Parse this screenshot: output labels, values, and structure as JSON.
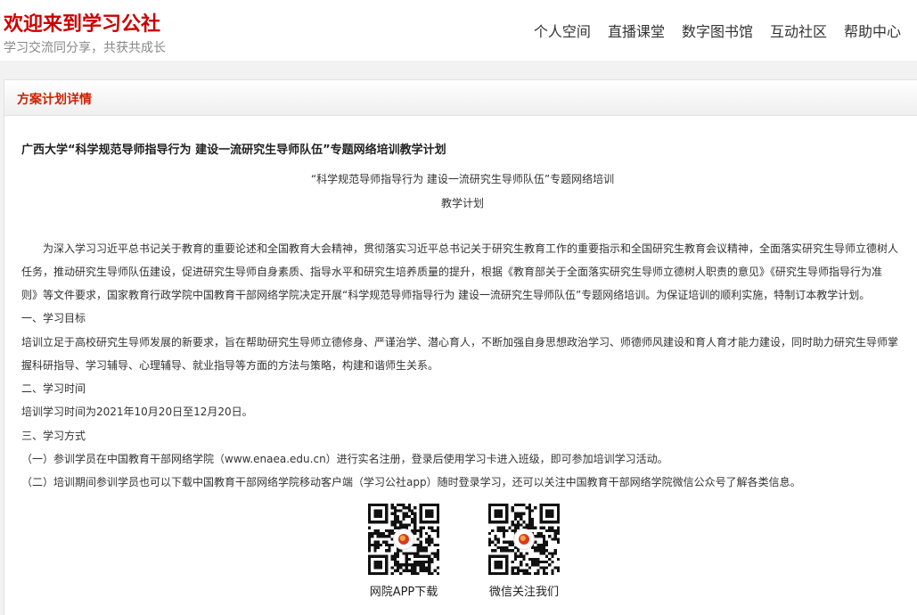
{
  "header": {
    "title": "欢迎来到学习公社",
    "slogan": "学习交流同分享，共获共成长",
    "nav": [
      "个人空间",
      "直播课堂",
      "数字图书馆",
      "互动社区",
      "帮助中心"
    ]
  },
  "panel": {
    "heading": "方案计划详情"
  },
  "doc": {
    "title": "广西大学“科学规范导师指导行为 建设一流研究生导师队伍”专题网络培训教学计划",
    "subtitle_line1": "“科学规范导师指导行为 建设一流研究生导师队伍”专题网络培训",
    "subtitle_line2": "教学计划",
    "intro_1": "为深入学习习近平总书记关于教育的重要论述和全国教育大会精神，贯彻落实习近平总书记关于研究生教育工作的重要指示和全国研究生教育会议精神，全面落实研究生导师立德树人",
    "intro_2": "任务，推动研究生导师队伍建设，促进研究生导师自身素质、指导水平和研究生培养质量的提升，根据《教育部关于全面落实研究生导师立德树人职责的意见》《研究生导师指导行为准",
    "intro_3": "则》等文件要求，国家教育行政学院中国教育干部网络学院决定开展“科学规范导师指导行为 建设一流研究生导师队伍”专题网络培训。为保证培训的顺利实施，特制订本教学计划。",
    "sec1_title": "一、学习目标",
    "sec1_text_1": "培训立足于高校研究生导师发展的新要求，旨在帮助研究生导师立德修身、严谨治学、潜心育人，不断加强自身思想政治学习、师德师风建设和育人育才能力建设，同时助力研究生导师掌",
    "sec1_text_2": "握科研指导、学习辅导、心理辅导、就业指导等方面的方法与策略，构建和谐师生关系。",
    "sec2_title": "二、学习时间",
    "sec2_text": "培训学习时间为2021年10月20日至12月20日。",
    "sec3_title": "三、学习方式",
    "sec3_item1": "（一）参训学员在中国教育干部网络学院（www.enaea.edu.cn）进行实名注册，登录后使用学习卡进入班级，即可参加培训学习活动。",
    "sec3_item2": "（二）培训期间参训学员也可以下载中国教育干部网络学院移动客户端（学习公社app）随时登录学习，还可以关注中国教育干部网络学院微信公众号了解各类信息。"
  },
  "qr": [
    {
      "caption": "网院APP下载",
      "icon": "qr-code-icon"
    },
    {
      "caption": "微信关注我们",
      "icon": "qr-code-icon"
    }
  ]
}
